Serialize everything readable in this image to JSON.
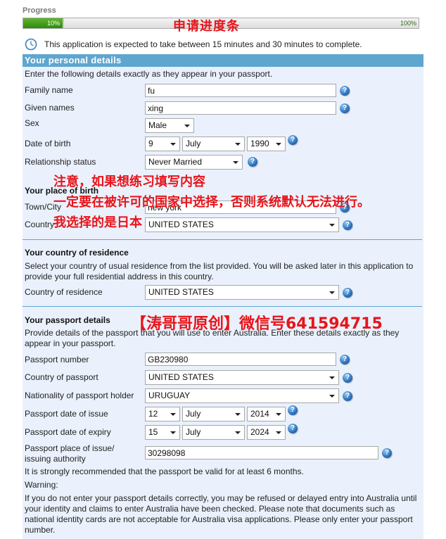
{
  "progress": {
    "label": "Progress",
    "percent": 10,
    "start_text": "10%",
    "end_text": "100%",
    "annotation": "申请进度条"
  },
  "time_note": {
    "icon": "clock-icon",
    "text": "This application is expected to take between 15 minutes and 30 minutes to complete."
  },
  "personal": {
    "header": "Your personal details",
    "intro": "Enter the following details exactly as they appear in your passport.",
    "family_name": {
      "label": "Family name",
      "value": "fu"
    },
    "given_names": {
      "label": "Given names",
      "value": "xing"
    },
    "sex": {
      "label": "Sex",
      "value": "Male"
    },
    "dob": {
      "label": "Date of birth",
      "day": "9",
      "month": "July",
      "year": "1990"
    },
    "relationship": {
      "label": "Relationship status",
      "value": "Never Married"
    }
  },
  "birth": {
    "heading": "Your place of birth",
    "town": {
      "label": "Town/City",
      "value": "new york"
    },
    "country": {
      "label": "Country",
      "value": "UNITED STATES"
    }
  },
  "residence": {
    "heading": "Your country of residence",
    "intro": "Select your country of usual residence from the list provided. You will be asked later in this application to provide your full residential address in this country.",
    "country": {
      "label": "Country of residence",
      "value": "UNITED STATES"
    }
  },
  "passport": {
    "heading": "Your passport details",
    "intro": "Provide details of the passport that you will use to enter Australia. Enter these details exactly as they appear in your passport.",
    "number": {
      "label": "Passport number",
      "value": "GB230980"
    },
    "country": {
      "label": "Country of passport",
      "value": "UNITED STATES"
    },
    "nationality": {
      "label": "Nationality of passport holder",
      "value": "URUGUAY"
    },
    "issue_date": {
      "label": "Passport date of issue",
      "day": "12",
      "month": "July",
      "year": "2014"
    },
    "expiry_date": {
      "label": "Passport date of expiry",
      "day": "15",
      "month": "July",
      "year": "2024"
    },
    "place_of_issue": {
      "label_line1": "Passport place of issue/",
      "label_line2": "issuing authority",
      "value": "30298098"
    },
    "recommendation": "It is strongly recommended that the passport be valid for at least 6 months.",
    "warning_label": "Warning:",
    "warning_text": "If you do not enter your passport details correctly, you may be refused or delayed entry into Australia until your identity and claims to enter Australia have been checked. Please note that documents such as national identity cards are not acceptable for Australia visa applications. Please only enter your passport number."
  },
  "overlay_annotations": {
    "line1": "注意，如果想练习填写内容",
    "line2": "一定要在被许可的国家中选择，否则系统默认无法进行。",
    "line3": "我选择的是日本",
    "watermark": "【涛哥哥原创】微信号641594715"
  },
  "help_glyph": "?",
  "colors": {
    "header_blue": "#5fa6cf",
    "panel_bg": "#eaf1fc",
    "progress_green": "#3a9a1a",
    "annotation_red": "#e8141a"
  }
}
